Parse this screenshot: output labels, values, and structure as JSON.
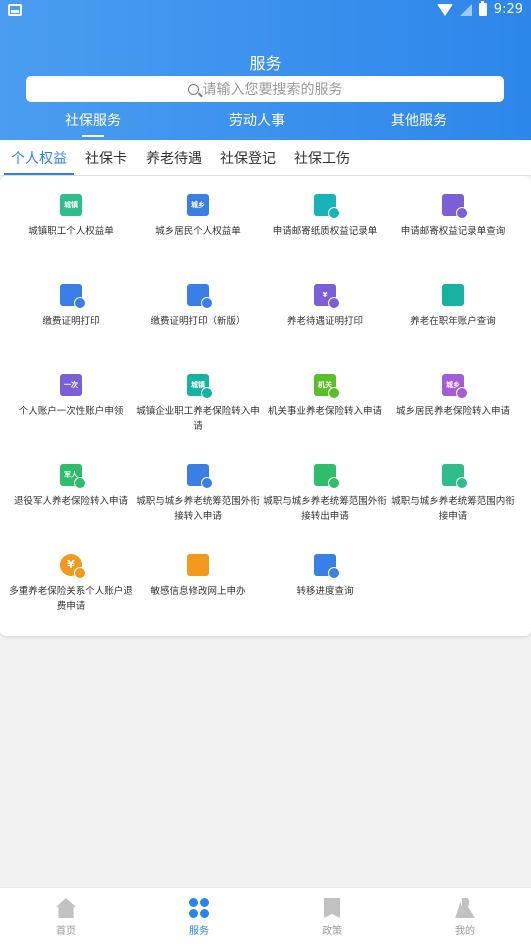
{
  "status_bar": {
    "time": "9:29"
  },
  "header": {
    "title": "服务",
    "search_placeholder": "请输入您要搜索的服务",
    "tabs": [
      "社保服务",
      "劳动人事",
      "其他服务"
    ]
  },
  "subtabs": [
    "个人权益",
    "社保卡",
    "养老待遇",
    "社保登记",
    "社保工伤"
  ],
  "items": [
    {
      "label": "城镇职工个人权益单",
      "icon": "document-icon",
      "color": "#2ebd8b",
      "badge": "城镇"
    },
    {
      "label": "城乡居民个人权益单",
      "icon": "document-icon",
      "color": "#3a7fe6",
      "badge": "城乡"
    },
    {
      "label": "申请邮寄纸质权益记录单",
      "icon": "mail-truck-icon",
      "color": "#16b3b8",
      "badge": ""
    },
    {
      "label": "申请邮寄权益记录单查询",
      "icon": "doc-search-icon",
      "color": "#7b5fd6",
      "badge": ""
    },
    {
      "label": "缴费证明打印",
      "icon": "print-icon",
      "color": "#3a7fe6",
      "badge": ""
    },
    {
      "label": "缴费证明打印（新版）",
      "icon": "print-icon",
      "color": "#3a7fe6",
      "badge": ""
    },
    {
      "label": "养老待遇证明打印",
      "icon": "print-icon",
      "color": "#7b5fd6",
      "badge": "¥"
    },
    {
      "label": "养老在职年账户查询",
      "icon": "account-icon",
      "color": "#16b3a0",
      "badge": ""
    },
    {
      "label": "个人账户一次性账户申领",
      "icon": "card-icon",
      "color": "#7b5fd6",
      "badge": "一次"
    },
    {
      "label": "城镇企业职工养老保险转入申请",
      "icon": "transfer-in-icon",
      "color": "#16b3a0",
      "badge": "城镇"
    },
    {
      "label": "机关事业养老保险转入申请",
      "icon": "transfer-in-icon",
      "color": "#5cbf2a",
      "badge": "机关"
    },
    {
      "label": "城乡居民养老保险转入申请",
      "icon": "transfer-in-icon",
      "color": "#a55cd6",
      "badge": "城乡"
    },
    {
      "label": "退役军人养老保险转入申请",
      "icon": "transfer-in-icon",
      "color": "#2ebd6b",
      "badge": "军人"
    },
    {
      "label": "城职与城乡养老统筹范围外衔接转入申请",
      "icon": "transfer-in-icon",
      "color": "#3a7fe6",
      "badge": ""
    },
    {
      "label": "城职与城乡养老统筹范围外衔接转出申请",
      "icon": "transfer-out-icon",
      "color": "#2ebd6b",
      "badge": ""
    },
    {
      "label": "城职与城乡养老统筹范围内衔接申请",
      "icon": "edit-doc-icon",
      "color": "#2ebd8b",
      "badge": ""
    },
    {
      "label": "多重养老保险关系个人账户退费申请",
      "icon": "yuan-icon",
      "color": "#f39a1e",
      "badge": "¥"
    },
    {
      "label": "敏感信息修改网上申办",
      "icon": "message-icon",
      "color": "#f39a1e",
      "badge": ""
    },
    {
      "label": "转移进度查询",
      "icon": "progress-icon",
      "color": "#3a7fe6",
      "badge": ""
    }
  ],
  "bottom_nav": [
    "首页",
    "服务",
    "政策",
    "我的"
  ]
}
